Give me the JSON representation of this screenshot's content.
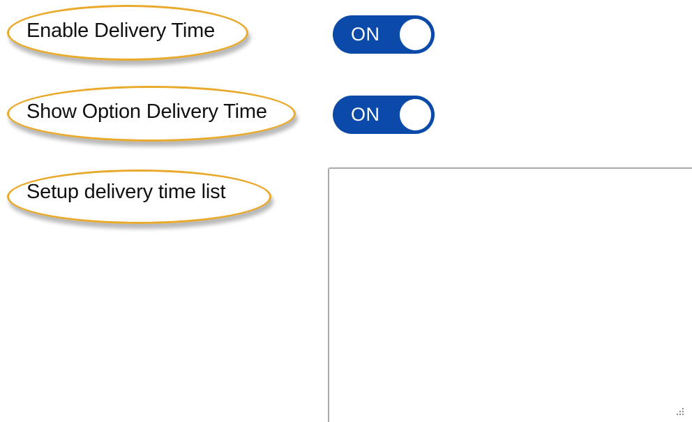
{
  "settings": {
    "enable_delivery_time": {
      "label": "Enable Delivery Time",
      "toggle_text": "ON",
      "enabled": true
    },
    "show_option_delivery_time": {
      "label": "Show Option Delivery Time",
      "toggle_text": "ON",
      "enabled": true
    },
    "setup_delivery_time_list": {
      "label": "Setup delivery time list",
      "value": ""
    }
  },
  "colors": {
    "toggle_on": "#0b4aa8",
    "highlight_ring": "#e9a92a",
    "textarea_border": "#a9a9a9"
  },
  "icons": {
    "resize_grip": "resize-grip-icon"
  }
}
